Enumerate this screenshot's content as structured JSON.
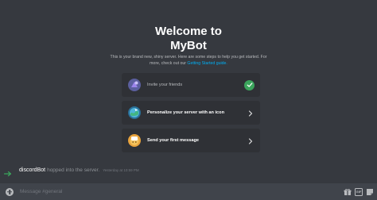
{
  "welcome": {
    "title_line1": "Welcome to",
    "title_line2": "MyBot",
    "desc_text": "This is your brand new, shiny server. Here are some steps to help you get started. For more, check out our ",
    "desc_link": "Getting Started guide."
  },
  "actions": [
    {
      "label": "Invite your friends",
      "icon": "invite-friends-icon",
      "status": "completed",
      "status_icon": "check-icon",
      "color": "#9b84ec"
    },
    {
      "label": "Personalize your server with an icon",
      "icon": "server-icon-globe",
      "status": "pending",
      "status_icon": "chevron-right-icon",
      "color": "#4fb3d9"
    },
    {
      "label": "Send your first message",
      "icon": "message-icon",
      "status": "pending",
      "status_icon": "chevron-right-icon",
      "color": "#f5c35c"
    }
  ],
  "join_message": {
    "username": "discordBot",
    "text": "hopped into the server.",
    "timestamp": "Yesterday at 10:59 PM"
  },
  "composer": {
    "placeholder": "Message #general",
    "gif_label": "GIF"
  },
  "colors": {
    "background": "#36393f",
    "card": "#2f3136",
    "composer": "#40444b",
    "link": "#00aff4",
    "success": "#3ba55c",
    "join_arrow": "#3ba55c"
  }
}
